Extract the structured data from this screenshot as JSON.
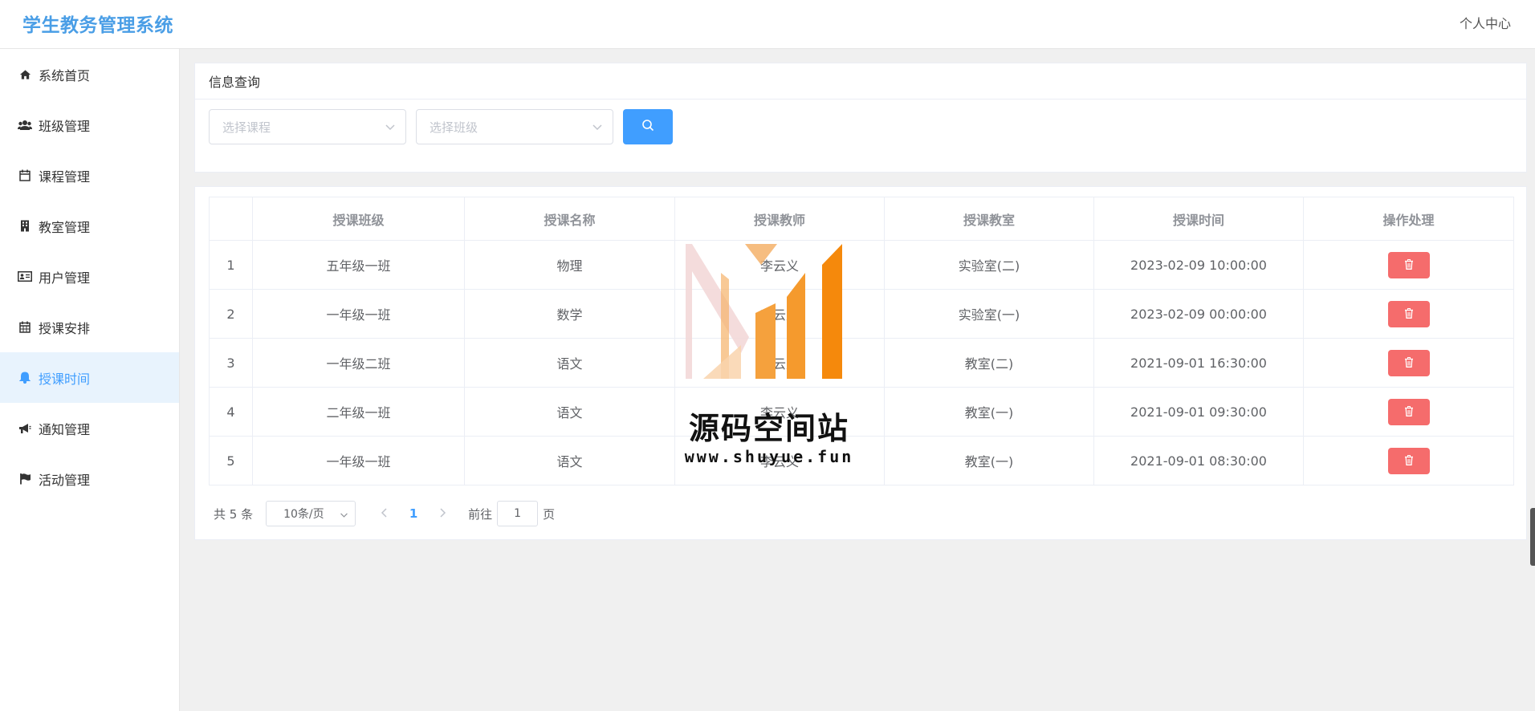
{
  "header": {
    "brand": "学生教务管理系统",
    "user_center": "个人中心"
  },
  "sidebar": {
    "items": [
      {
        "label": "系统首页",
        "icon": "home-icon"
      },
      {
        "label": "班级管理",
        "icon": "users-icon"
      },
      {
        "label": "课程管理",
        "icon": "calendar-icon"
      },
      {
        "label": "教室管理",
        "icon": "building-icon"
      },
      {
        "label": "用户管理",
        "icon": "id-card-icon"
      },
      {
        "label": "授课安排",
        "icon": "calendar-grid-icon"
      },
      {
        "label": "授课时间",
        "icon": "bell-icon",
        "active": true
      },
      {
        "label": "通知管理",
        "icon": "bullhorn-icon"
      },
      {
        "label": "活动管理",
        "icon": "flag-icon"
      }
    ]
  },
  "query": {
    "title": "信息查询",
    "course_placeholder": "选择课程",
    "class_placeholder": "选择班级",
    "search_icon": "search-icon"
  },
  "table": {
    "columns": [
      "",
      "授课班级",
      "授课名称",
      "授课教师",
      "授课教室",
      "授课时间",
      "操作处理"
    ],
    "rows": [
      {
        "index": "1",
        "class": "五年级一班",
        "course": "物理",
        "teacher": "李云义",
        "room": "实验室(二)",
        "time": "2023-02-09 10:00:00"
      },
      {
        "index": "2",
        "class": "一年级一班",
        "course": "数学",
        "teacher": "李云义",
        "room": "实验室(一)",
        "time": "2023-02-09 00:00:00"
      },
      {
        "index": "3",
        "class": "一年级二班",
        "course": "语文",
        "teacher": "李云义",
        "room": "教室(二)",
        "time": "2021-09-01 16:30:00"
      },
      {
        "index": "4",
        "class": "二年级一班",
        "course": "语文",
        "teacher": "李云义",
        "room": "教室(一)",
        "time": "2021-09-01 09:30:00"
      },
      {
        "index": "5",
        "class": "一年级一班",
        "course": "语文",
        "teacher": "李云义",
        "room": "教室(一)",
        "time": "2021-09-01 08:30:00"
      }
    ],
    "delete_icon": "trash-icon"
  },
  "pagination": {
    "total": "共 5 条",
    "page_size": "10条/页",
    "current_page": "1",
    "goto_label": "前往",
    "goto_value": "1",
    "page_unit": "页"
  },
  "watermark": {
    "text": "源码空间站",
    "url": "www.shuyue.fun"
  },
  "colors": {
    "primary": "#409eff",
    "danger": "#f56c6c",
    "brand": "#4a9ee6",
    "watermark_orange": "#f5890c"
  }
}
